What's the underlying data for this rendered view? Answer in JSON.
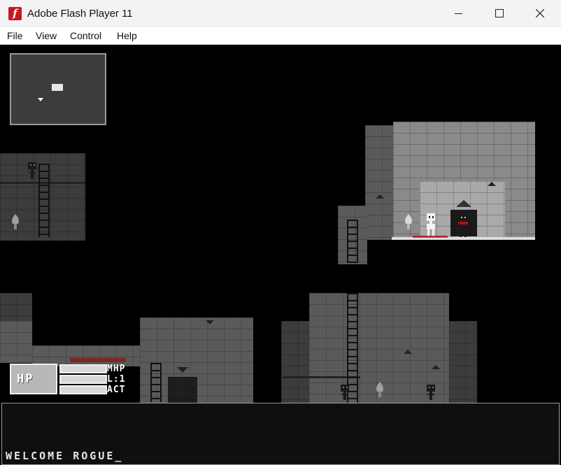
{
  "window": {
    "title": "Adobe Flash Player 11",
    "app_icon": "flash-player-icon",
    "controls": [
      "minimize-icon",
      "maximize-icon",
      "close-icon"
    ]
  },
  "menu": {
    "items": [
      {
        "label": "File"
      },
      {
        "label": "View"
      },
      {
        "label": "Control"
      },
      {
        "label": "Help"
      }
    ]
  },
  "hud": {
    "hp_label": "HP",
    "stats": [
      {
        "label": "MHP"
      },
      {
        "label": "L:1"
      },
      {
        "label": "ACT"
      }
    ]
  },
  "log": {
    "message": "WELCOME ROGUE_"
  },
  "colors": {
    "titlebar": "#f3f3f3",
    "flash_red": "#c8181e",
    "blood": "#b01010"
  }
}
